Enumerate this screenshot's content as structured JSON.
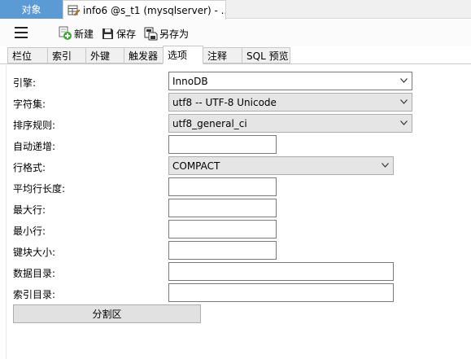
{
  "tabs": {
    "objects_label": "对象",
    "doc_title": "info6 @s_t1 (mysqlserver) - ..."
  },
  "toolbar": {
    "new_label": "新建",
    "save_label": "保存",
    "save_as_label": "另存为"
  },
  "subtabs": [
    "栏位",
    "索引",
    "外键",
    "触发器",
    "选项",
    "注释",
    "SQL 预览"
  ],
  "active_subtab": "选项",
  "form": {
    "engine_label": "引擎:",
    "engine_value": "InnoDB",
    "charset_label": "字符集:",
    "charset_value": "utf8 -- UTF-8 Unicode",
    "collation_label": "排序规则:",
    "collation_value": "utf8_general_ci",
    "auto_increment_label": "自动递增:",
    "auto_increment_value": "",
    "row_format_label": "行格式:",
    "row_format_value": "COMPACT",
    "avg_row_length_label": "平均行长度:",
    "avg_row_length_value": "",
    "max_rows_label": "最大行:",
    "max_rows_value": "",
    "min_rows_label": "最小行:",
    "min_rows_value": "",
    "key_block_size_label": "键块大小:",
    "key_block_size_value": "",
    "data_directory_label": "数据目录:",
    "data_directory_value": "",
    "index_directory_label": "索引目录:",
    "index_directory_value": ""
  },
  "partition_button_label": "分割区",
  "colors": {
    "objects_tab_bg": "#5b9bd5",
    "new_icon_green": "#3aa935"
  },
  "icons": [
    "menu-icon",
    "new-icon",
    "save-icon",
    "save-as-icon",
    "table-edit-icon",
    "chevron-down-icon"
  ]
}
